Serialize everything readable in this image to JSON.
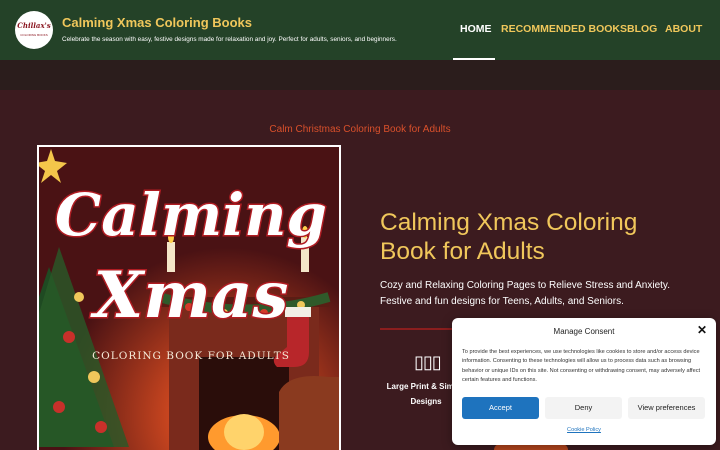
{
  "header": {
    "logo": {
      "line1": "Chillax's",
      "line2": "COLORING BOOKS"
    },
    "site_title": "Calming Xmas Coloring Books",
    "tagline": "Celebrate the season with easy, festive designs made for relaxation and joy. Perfect for adults, seniors, and beginners.",
    "nav": [
      "HOME",
      "RECOMMENDED BOOKS",
      "BLOG",
      "ABOUT"
    ],
    "active_nav": "HOME"
  },
  "main": {
    "section_label": "Calm Christmas Coloring Book for Adults",
    "cover": {
      "title_line1": "Calming",
      "title_line2": "Xmas",
      "subtitle": "COLORING BOOK FOR ADULTS"
    },
    "book_title": "Calming Xmas Coloring Book for Adults",
    "description": "Cozy and Relaxing Coloring Pages to Relieve Stress and Anxiety. Festive and fun designs for Teens, Adults, and Seniors.",
    "feature": {
      "icon": "book-pages-icon",
      "label": "Large Print & Simple Designs"
    }
  },
  "consent": {
    "title": "Manage Consent",
    "text": "To provide the best experiences, we use technologies like cookies to store and/or access device information. Consenting to these technologies will allow us to process data such as browsing behavior or unique IDs on this site. Not consenting or withdrawing consent, may adversely affect certain features and functions.",
    "accept": "Accept",
    "deny": "Deny",
    "preferences": "View preferences",
    "policy_link": "Cookie Policy"
  },
  "colors": {
    "header_bg": "#244228",
    "page_bg": "#3c1b1f",
    "accent_gold": "#f0c75b",
    "accent_orange": "#d9502b",
    "button_blue": "#1e73be"
  }
}
